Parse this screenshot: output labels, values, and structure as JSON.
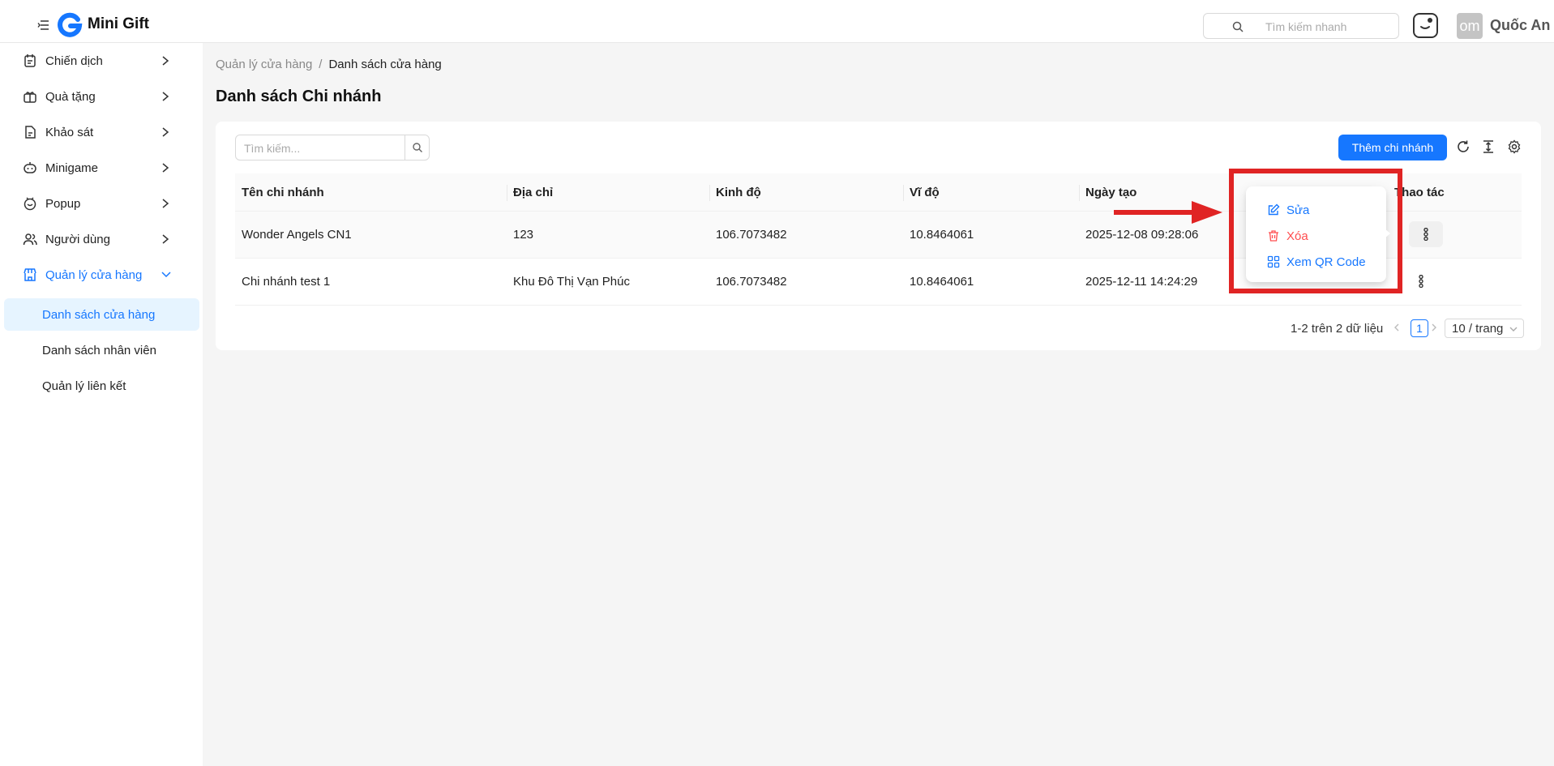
{
  "header": {
    "app_title": "Mini Gift",
    "quick_search_placeholder": "Tìm kiếm nhanh",
    "avatar_initials": "om",
    "user_name": "Quốc An"
  },
  "sidebar": {
    "items": [
      {
        "label": "Chiến dịch",
        "icon": "campaign-icon"
      },
      {
        "label": "Quà tặng",
        "icon": "gift-icon"
      },
      {
        "label": "Khảo sát",
        "icon": "survey-icon"
      },
      {
        "label": "Minigame",
        "icon": "game-icon"
      },
      {
        "label": "Popup",
        "icon": "popup-icon"
      },
      {
        "label": "Người dùng",
        "icon": "users-icon"
      },
      {
        "label": "Quản lý cửa hàng",
        "icon": "store-icon"
      }
    ],
    "sub_items": [
      {
        "label": "Danh sách cửa hàng"
      },
      {
        "label": "Danh sách nhân viên"
      },
      {
        "label": "Quản lý liên kết"
      }
    ]
  },
  "breadcrumb": {
    "parent": "Quản lý cửa hàng",
    "separator": "/",
    "current": "Danh sách cửa hàng"
  },
  "page_title": "Danh sách Chi nhánh",
  "toolbar": {
    "search_placeholder": "Tìm kiếm...",
    "add_label": "Thêm chi nhánh"
  },
  "table": {
    "columns": [
      "Tên chi nhánh",
      "Địa chỉ",
      "Kinh độ",
      "Vĩ độ",
      "Ngày tạo",
      "Thao tác"
    ],
    "rows": [
      {
        "name": "Wonder Angels CN1",
        "address": "123",
        "longitude": "106.7073482",
        "latitude": "10.8464061",
        "created": "2025-12-08 09:28:06"
      },
      {
        "name": "Chi nhánh test 1",
        "address": "Khu Đô Thị Vạn Phúc",
        "longitude": "106.7073482",
        "latitude": "10.8464061",
        "created": "2025-12-11 14:24:29"
      }
    ]
  },
  "pagination": {
    "info": "1-2 trên 2 dữ liệu",
    "current_page": "1",
    "page_size": "10 / trang"
  },
  "dropdown": {
    "edit": "Sửa",
    "delete": "Xóa",
    "qr": "Xem QR Code"
  },
  "colors": {
    "primary": "#1677ff",
    "danger": "#ff4d4f",
    "annotation": "#e02424"
  }
}
